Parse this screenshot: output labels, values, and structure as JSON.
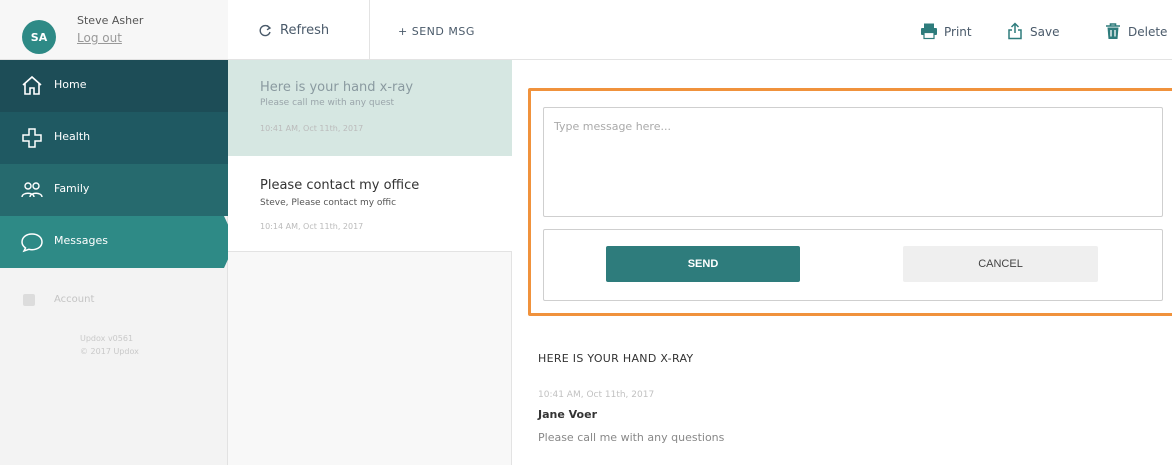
{
  "user": {
    "initials": "SA",
    "name": "Steve Asher",
    "logout_label": "Log out"
  },
  "nav": {
    "home": "Home",
    "health": "Health",
    "family": "Family",
    "messages": "Messages",
    "account": "Account",
    "footer_version": "Updox v0561",
    "footer_copyright": "© 2017 Updox"
  },
  "list_toolbar": {
    "refresh_label": "Refresh",
    "send_msg_label": "+ SEND MSG"
  },
  "messages": [
    {
      "subject": "Here is your hand x-ray",
      "preview": "Please call me with any quest",
      "time": "10:41 AM, Oct 11th, 2017"
    },
    {
      "subject": "Please contact my office",
      "preview": "Steve, Please contact my offic",
      "time": "10:14 AM, Oct 11th, 2017"
    }
  ],
  "detail_toolbar": {
    "print_label": "Print",
    "save_label": "Save",
    "delete_label": "Delete"
  },
  "compose": {
    "placeholder": "Type message here...",
    "send_label": "SEND",
    "cancel_label": "CANCEL"
  },
  "detail": {
    "subject": "HERE IS YOUR HAND X-RAY",
    "time": "10:41 AM, Oct 11th, 2017",
    "sender": "Jane Voer",
    "body": "Please call me with any questions"
  },
  "colors": {
    "accent": "#2e8a86",
    "highlight": "#f0923c",
    "nav_dark": "#1d4d57"
  }
}
